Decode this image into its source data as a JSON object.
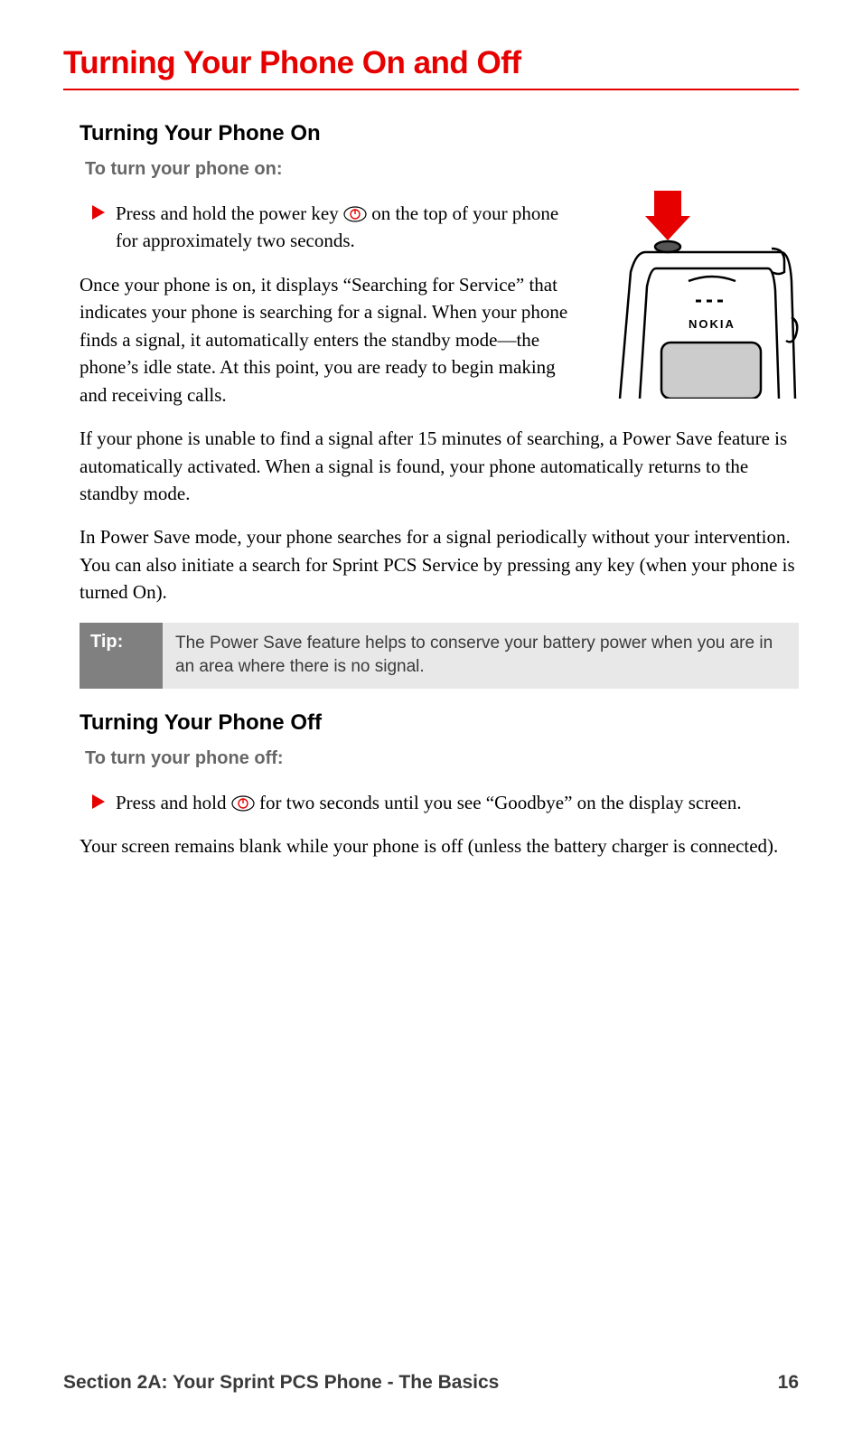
{
  "title": "Turning Your Phone On and Off",
  "section_on": {
    "heading": "Turning Your Phone On",
    "lead": "To turn your phone on:",
    "bullet_pre": "Press and hold the power key ",
    "bullet_post": " on the top of your phone for approximately two seconds.",
    "p1": "Once your phone is on, it displays “Searching for Service” that indicates your phone is searching for a signal. When your phone finds a signal, it automatically enters the standby mode—the phone’s idle state. At this point, you are ready to begin making and receiving calls.",
    "p2": "If your phone is unable to find a signal after 15 minutes of searching, a Power Save feature is automatically activated. When a signal is found, your phone automatically returns to the standby mode.",
    "p3": "In Power Save mode, your phone searches for a signal periodically without your intervention. You can also initiate a search for Sprint PCS Service by pressing any key (when your phone is turned On)."
  },
  "tip": {
    "label": "Tip:",
    "text": "The Power Save feature helps to conserve your battery power when you are in an area where there is no signal."
  },
  "section_off": {
    "heading": "Turning Your Phone Off",
    "lead": "To turn your phone off:",
    "bullet_pre": "Press and hold ",
    "bullet_post": " for two seconds until you see “Goodbye” on the display screen.",
    "p1": "Your screen remains blank while your phone is off (unless the battery charger is connected)."
  },
  "footer": {
    "section": "Section 2A: Your Sprint PCS Phone - The Basics",
    "page": "16"
  },
  "phone_brand": "NOKIA",
  "icons": {
    "power": "power-key-icon",
    "bullet_arrow": "red-arrow-icon",
    "phone_illustration": "nokia-phone-top-illustration"
  }
}
